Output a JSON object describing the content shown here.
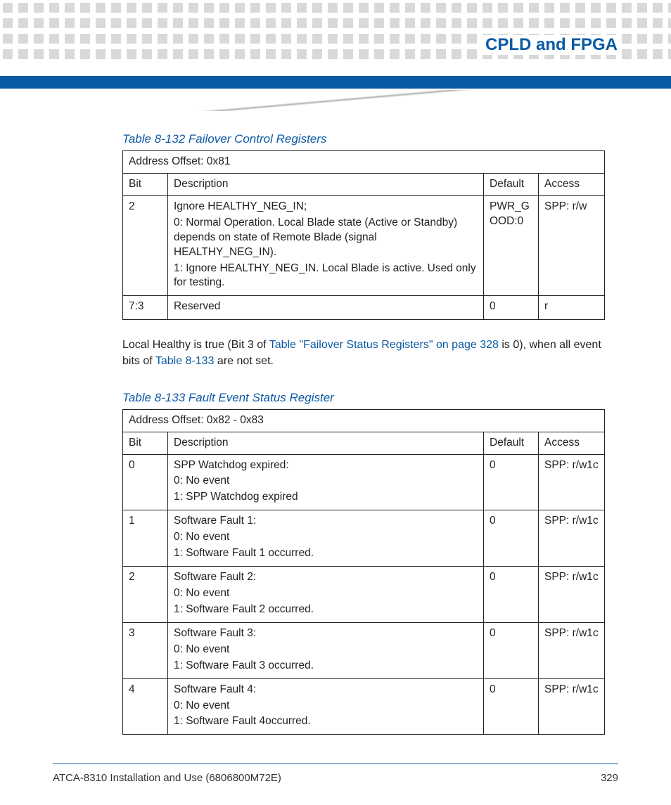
{
  "header": {
    "section_title": "CPLD and FPGA"
  },
  "table1": {
    "caption": "Table 8-132 Failover Control Registers",
    "address_row": "Address Offset: 0x81",
    "cols": {
      "bit": "Bit",
      "desc": "Description",
      "def": "Default",
      "acc": "Access"
    },
    "rows": [
      {
        "bit": "2",
        "desc_lines": [
          "Ignore HEALTHY_NEG_IN;",
          "0: Normal Operation. Local Blade state (Active or Standby) depends on state of Remote Blade (signal HEALTHY_NEG_IN).",
          "1: Ignore HEALTHY_NEG_IN. Local Blade is active. Used only for testing."
        ],
        "def": "PWR_GOOD:0",
        "acc": "SPP: r/w"
      },
      {
        "bit": "7:3",
        "desc_lines": [
          "Reserved"
        ],
        "def": "0",
        "acc": "r"
      }
    ]
  },
  "para": {
    "t1": "Local Healthy is true (Bit 3 of ",
    "link1": "Table \"Failover Status Registers\" on page 328",
    "t2": " is 0), when all event bits of ",
    "link2": "Table 8-133",
    "t3": " are not set."
  },
  "table2": {
    "caption": "Table 8-133 Fault Event Status Register",
    "address_row": "Address Offset: 0x82 - 0x83",
    "cols": {
      "bit": "Bit",
      "desc": "Description",
      "def": "Default",
      "acc": "Access"
    },
    "rows": [
      {
        "bit": "0",
        "desc_lines": [
          "SPP Watchdog expired:",
          "0: No event",
          "1: SPP Watchdog expired"
        ],
        "def": "0",
        "acc": "SPP: r/w1c"
      },
      {
        "bit": "1",
        "desc_lines": [
          "Software Fault 1:",
          "0: No event",
          "1: Software Fault 1 occurred."
        ],
        "def": "0",
        "acc": "SPP: r/w1c"
      },
      {
        "bit": "2",
        "desc_lines": [
          "Software Fault 2:",
          "0: No event",
          "1: Software Fault 2 occurred."
        ],
        "def": "0",
        "acc": "SPP: r/w1c"
      },
      {
        "bit": "3",
        "desc_lines": [
          "Software Fault 3:",
          "0: No event",
          "1: Software Fault 3 occurred."
        ],
        "def": "0",
        "acc": "SPP: r/w1c"
      },
      {
        "bit": "4",
        "desc_lines": [
          "Software Fault 4:",
          "0: No event",
          "1: Software Fault 4occurred."
        ],
        "def": "0",
        "acc": "SPP: r/w1c"
      }
    ]
  },
  "footer": {
    "left": "ATCA-8310 Installation and Use (6806800M72E)",
    "right": "329"
  }
}
